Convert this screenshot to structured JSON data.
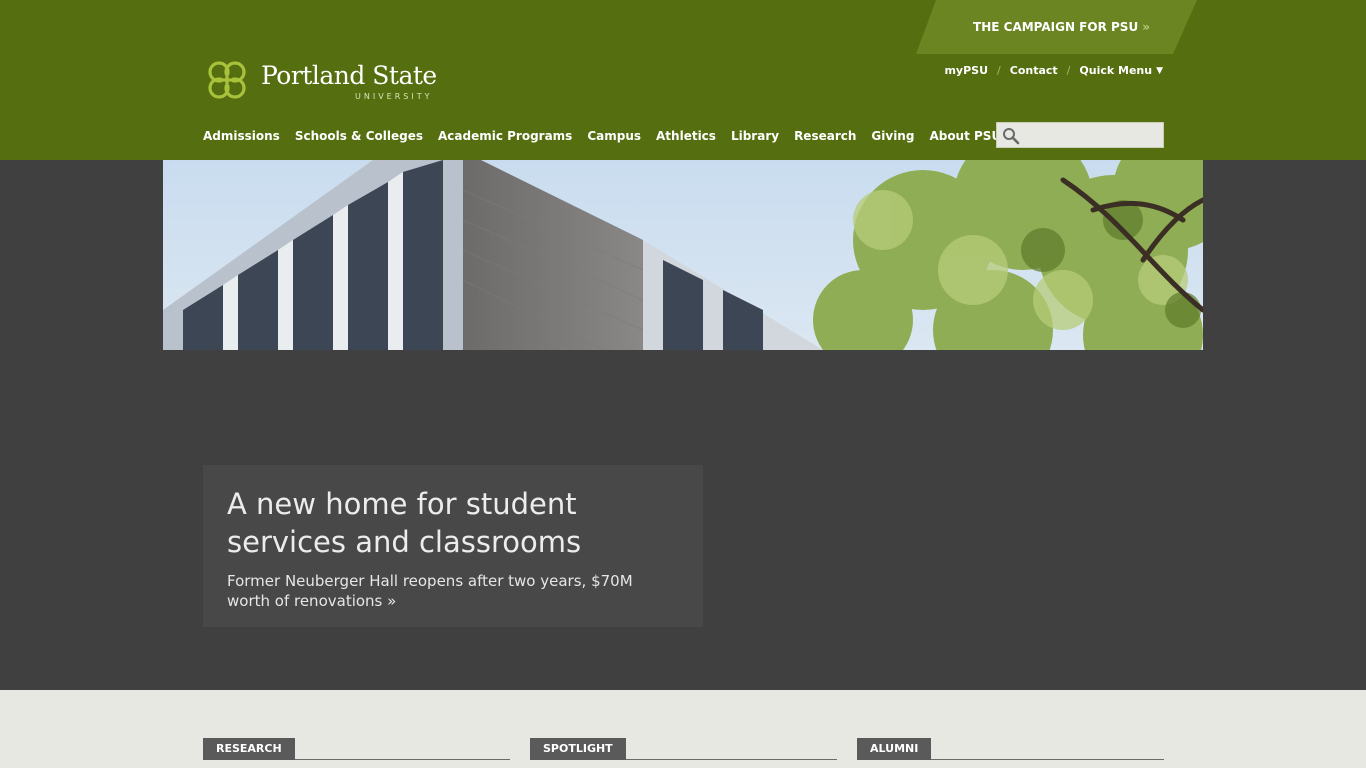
{
  "header": {
    "campaign": {
      "label": "THE CAMPAIGN FOR PSU",
      "arrow": "»"
    },
    "logo": {
      "name": "Portland State",
      "sub": "UNIVERSITY"
    },
    "utility": {
      "mypsu": "myPSU",
      "sep1": "/",
      "contact": "Contact",
      "sep2": "/",
      "quick_menu": "Quick Menu",
      "caret": "▼"
    },
    "nav": [
      {
        "label": "Admissions"
      },
      {
        "label": "Schools & Colleges"
      },
      {
        "label": "Academic Programs"
      },
      {
        "label": "Campus"
      },
      {
        "label": "Athletics"
      },
      {
        "label": "Library"
      },
      {
        "label": "Research"
      },
      {
        "label": "Giving"
      },
      {
        "label": "About PSU"
      }
    ],
    "search": {
      "placeholder": "",
      "value": ""
    }
  },
  "hero": {
    "title": "A new home for student services and classrooms",
    "subtitle": "Former Neuberger Hall reopens after two years, $70M worth of renovations »"
  },
  "sections": {
    "research": "RESEARCH",
    "spotlight": "SPOTLIGHT",
    "alumni": "ALUMNI"
  },
  "colors": {
    "header_green": "#556e0f",
    "campaign_green": "#6a8522",
    "logo_green": "#a9c23b",
    "hero_bg": "#404040",
    "section_bg": "#e8e8e3"
  }
}
